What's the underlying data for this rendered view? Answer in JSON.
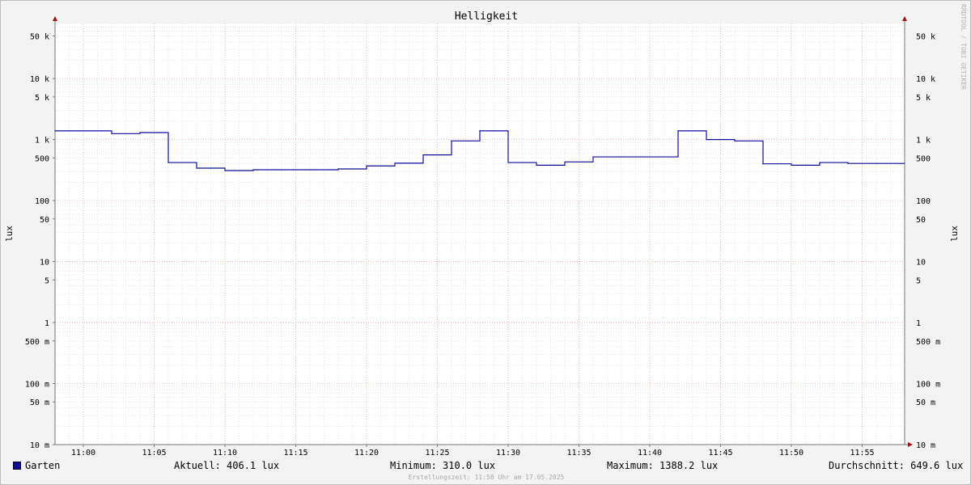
{
  "chart_data": {
    "type": "line",
    "title": "Helligkeit",
    "ylabel": "lux",
    "y_scale": "log",
    "ylim": [
      0.01,
      80000
    ],
    "xlim": [
      "10:58",
      "11:58"
    ],
    "x_tick_labels": [
      "11:00",
      "11:05",
      "11:10",
      "11:15",
      "11:20",
      "11:25",
      "11:30",
      "11:35",
      "11:40",
      "11:45",
      "11:50",
      "11:55"
    ],
    "y_tick_labels": [
      "50 k",
      "10 k",
      "5 k",
      "1 k",
      "500",
      "100",
      "50",
      "10",
      "5",
      "1",
      "500 m",
      "100 m",
      "50 m",
      "10 m"
    ],
    "y_tick_values": [
      50000,
      10000,
      5000,
      1000,
      500,
      100,
      50,
      10,
      5,
      1,
      0.5,
      0.1,
      0.05,
      0.01
    ],
    "grid": true,
    "series": [
      {
        "name": "Garten",
        "color": "#0b0f9a",
        "x": [
          "10:58",
          "11:00",
          "11:02",
          "11:04",
          "11:06",
          "11:08",
          "11:10",
          "11:12",
          "11:14",
          "11:16",
          "11:18",
          "11:20",
          "11:22",
          "11:24",
          "11:26",
          "11:28",
          "11:30",
          "11:32",
          "11:34",
          "11:36",
          "11:38",
          "11:40",
          "11:42",
          "11:44",
          "11:46",
          "11:48",
          "11:50",
          "11:52",
          "11:54",
          "11:56"
        ],
        "values": [
          1388,
          1388,
          1250,
          1300,
          420,
          340,
          310,
          320,
          320,
          320,
          330,
          370,
          410,
          560,
          950,
          1388,
          420,
          380,
          430,
          520,
          520,
          520,
          1388,
          1000,
          950,
          400,
          380,
          420,
          406,
          406
        ]
      }
    ]
  },
  "legend": {
    "series_name": "Garten",
    "current": "Aktuell: 406.1 lux",
    "minimum": "Minimum: 310.0 lux",
    "maximum": "Maximum: 1388.2 lux",
    "average": "Durchschnitt: 649.6 lux"
  },
  "footer": {
    "created": "Erstellungszeit: 11:58 Uhr am 17.05.2025"
  },
  "watermark": "RRDTOOL / TOBI OETIKER"
}
